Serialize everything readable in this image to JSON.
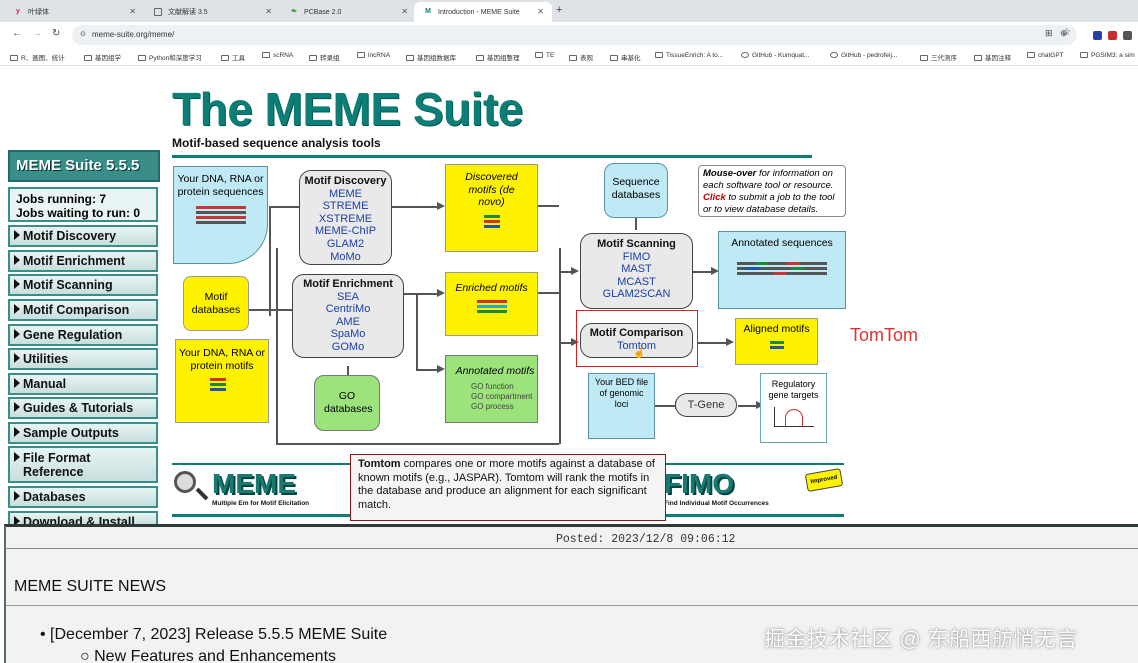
{
  "browser": {
    "tabs": [
      {
        "icon": "y",
        "title": "叶绿体"
      },
      {
        "icon": "doc",
        "title": "文献解读 3.5"
      },
      {
        "icon": "leaf",
        "title": "PCBase 2.0"
      },
      {
        "icon": "M",
        "title": "Introduction - MEME Suite"
      }
    ],
    "url": "meme-suite.org/meme/",
    "bookmarks": [
      "R、画图、统计",
      "基因组学",
      "Python和深度学习",
      "工具",
      "scRNA",
      "转录组",
      "lncRNA",
      "基因组数据库",
      "基因组整理",
      "TE",
      "表观",
      "串基化",
      "TissueEnrich: A to...",
      "GitHub - Kumquat...",
      "GitHub - pedrofeij...",
      "三代测序",
      "基因注释",
      "chatGPT",
      "PGSIM3: a sim"
    ]
  },
  "header": {
    "title": "The MEME Suite",
    "subtitle": "Motif-based sequence analysis tools"
  },
  "sidebar": {
    "version": "MEME Suite 5.5.5",
    "jobs_running": "Jobs running: 7",
    "jobs_waiting": "Jobs waiting to run: 0",
    "items": [
      "Motif Discovery",
      "Motif Enrichment",
      "Motif Scanning",
      "Motif Comparison",
      "Gene Regulation",
      "Utilities",
      "Manual",
      "Guides & Tutorials",
      "Sample Outputs",
      "File Format Reference",
      "Databases",
      "Download & Install"
    ]
  },
  "diagram": {
    "input_seqs": "Your DNA, RNA or protein sequences",
    "motif_databases": "Motif databases",
    "input_motifs": "Your DNA, RNA or protein motifs",
    "go_databases": "GO databases",
    "discovery": {
      "title": "Motif Discovery",
      "tools": [
        "MEME",
        "STREME",
        "XSTREME",
        "MEME-ChIP",
        "GLAM2",
        "MoMo"
      ]
    },
    "enrichment": {
      "title": "Motif Enrichment",
      "tools": [
        "SEA",
        "CentriMo",
        "AME",
        "SpaMo",
        "GOMo"
      ]
    },
    "discovered": "Discovered motifs (de novo)",
    "enriched": "Enriched motifs",
    "annotated_motifs": "Annotated motifs",
    "annotated_motif_items": [
      "GO function",
      "GO compartment",
      "GO process"
    ],
    "seq_databases": "Sequence databases",
    "scanning": {
      "title": "Motif Scanning",
      "tools": [
        "FIMO",
        "MAST",
        "MCAST",
        "GLAM2SCAN"
      ]
    },
    "comparison": {
      "title": "Motif Comparison",
      "tools": [
        "Tomtom"
      ]
    },
    "annotated_sequences": "Annotated sequences",
    "aligned_motifs": "Aligned motifs",
    "bed_file": "Your BED file of genomic loci",
    "tgene": "T-Gene",
    "reg_targets": "Regulatory gene targets",
    "info_mouseover": "Mouse-over",
    "info_text1": " for information on each software tool or resource.",
    "info_click": "Click",
    "info_text2": " to submit a job to the tool or to view database details.",
    "annotation_label": "TomTom"
  },
  "tooltip": {
    "name": "Tomtom",
    "text": " compares one or more motifs against a database of known motifs (e.g., JASPAR). Tomtom will rank the motifs in the database and produce an alignment for each significant match."
  },
  "logos": {
    "meme": "MEME",
    "meme_sub": "Multiple Em for Motif Elicitation",
    "fimo": "FIMO",
    "fimo_sub": "Find Individual Motif Occurrences",
    "improved": "Improved"
  },
  "news": {
    "posted": "Posted: 2023/12/8 09:06:12",
    "title": "MEME SUITE NEWS",
    "item": "[December 7, 2023] Release 5.5.5 MEME Suite",
    "subitem": "New Features and Enhancements"
  },
  "watermark": "掘金技术社区 @ 东船西舫悄无言"
}
